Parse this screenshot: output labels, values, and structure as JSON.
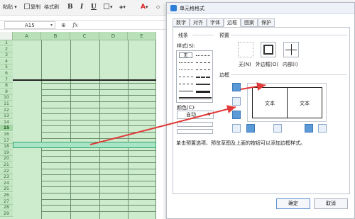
{
  "toolbar": {
    "paste": "粘贴",
    "copy": "复制",
    "format_painter": "格式刷",
    "bold": "B",
    "italic": "I",
    "underline": "U",
    "font_color": "A"
  },
  "formula_bar": {
    "name_box": "A15",
    "fx": "fx"
  },
  "sheet": {
    "columns": [
      "A",
      "B",
      "C",
      "D",
      "E"
    ],
    "rows": [
      "1",
      "2",
      "3",
      "4",
      "5",
      "6",
      "7",
      "8",
      "9",
      "10",
      "11",
      "12",
      "13",
      "14",
      "15",
      "16",
      "17",
      "18",
      "19",
      "20",
      "21",
      "22",
      "23",
      "24",
      "25",
      "26",
      "27",
      "28",
      "29"
    ],
    "active_row": "15"
  },
  "dialog": {
    "title": "单元格格式",
    "tabs": [
      "数字",
      "对齐",
      "字体",
      "边框",
      "图案",
      "保护"
    ],
    "active_tab": "边框",
    "line_group": "线条",
    "style_label": "样式(S):",
    "none_style": "无",
    "color_label": "颜色(C):",
    "color_value": "自动",
    "presets_group": "预置",
    "presets": [
      "无(N)",
      "外边框(O)",
      "内部(I)"
    ],
    "border_group": "边框",
    "preview_text": [
      "文本",
      "文本"
    ],
    "hint": "单击预置选项、预览草图及上面的按钮可以添加边框样式。",
    "ok": "确定",
    "cancel": "取消",
    "colors": {
      "accent": "#2e7dd7",
      "arrow": "#e03a3a"
    }
  }
}
